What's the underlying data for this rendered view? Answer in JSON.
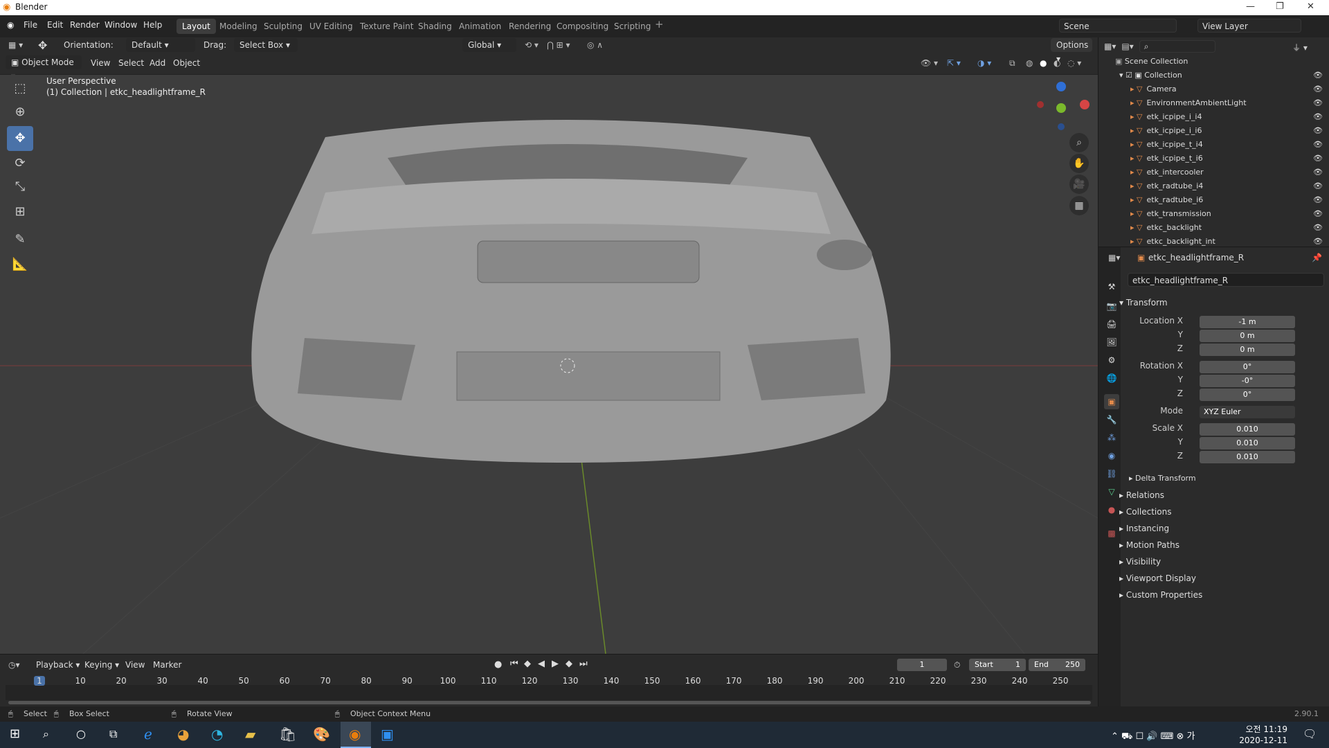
{
  "app": {
    "title": "Blender",
    "version": "2.90.1"
  },
  "menus": [
    "File",
    "Edit",
    "Render",
    "Window",
    "Help"
  ],
  "workspaces": [
    "Layout",
    "Modeling",
    "Sculpting",
    "UV Editing",
    "Texture Paint",
    "Shading",
    "Animation",
    "Rendering",
    "Compositing",
    "Scripting"
  ],
  "scene": {
    "name": "Scene",
    "view_layer": "View Layer"
  },
  "toolheader": {
    "orientation_label": "Orientation:",
    "orientation_value": "Default",
    "drag_label": "Drag:",
    "drag_value": "Select Box",
    "transform": "Global",
    "options": "Options"
  },
  "viewport_header": {
    "mode": "Object Mode",
    "view": "View",
    "select": "Select",
    "add": "Add",
    "object": "Object"
  },
  "viewport": {
    "perspective": "User Perspective",
    "collection_info": "(1) Collection | etkc_headlightframe_R"
  },
  "outliner": {
    "root": "Scene Collection",
    "collection": "Collection",
    "items": [
      "Camera",
      "EnvironmentAmbientLight",
      "etk_icpipe_i_i4",
      "etk_icpipe_i_i6",
      "etk_icpipe_t_i4",
      "etk_icpipe_t_i6",
      "etk_intercooler",
      "etk_radtube_i4",
      "etk_radtube_i6",
      "etk_transmission",
      "etkc_backlight",
      "etkc_backlight_int"
    ]
  },
  "properties": {
    "object_name": "etkc_headlightframe_R",
    "data_name": "etkc_headlightframe_R",
    "transform_title": "Transform",
    "location_label": "Location X",
    "location": [
      "-1 m",
      "0 m",
      "0 m"
    ],
    "rotation_label": "Rotation X",
    "rotation": [
      "0°",
      "-0°",
      "0°"
    ],
    "mode_label": "Mode",
    "mode_value": "XYZ Euler",
    "scale_label": "Scale X",
    "scale": [
      "0.010",
      "0.010",
      "0.010"
    ],
    "axis_y": "Y",
    "axis_z": "Z",
    "delta": "Delta Transform",
    "panels": [
      "Relations",
      "Collections",
      "Instancing",
      "Motion Paths",
      "Visibility",
      "Viewport Display",
      "Custom Properties"
    ]
  },
  "timeline": {
    "menus": [
      "Playback",
      "Keying",
      "View",
      "Marker"
    ],
    "current_frame": "1",
    "start_label": "Start",
    "start": "1",
    "end_label": "End",
    "end": "250",
    "ticks": [
      "1",
      "10",
      "20",
      "30",
      "40",
      "50",
      "60",
      "70",
      "80",
      "90",
      "100",
      "110",
      "120",
      "130",
      "140",
      "150",
      "160",
      "170",
      "180",
      "190",
      "200",
      "210",
      "220",
      "230",
      "240",
      "250"
    ]
  },
  "status": {
    "select": "Select",
    "box_select": "Box Select",
    "rotate_view": "Rotate View",
    "context_menu": "Object Context Menu"
  },
  "clock": {
    "time": "오전 11:19",
    "date": "2020-12-11"
  },
  "colors": {
    "accent": "#4a72a8",
    "viewport_bg": "#3d3d3d",
    "panel_bg": "#2b2b2b",
    "mesh_icon": "#e0894a",
    "vertex_icon": "#5ad08f"
  }
}
